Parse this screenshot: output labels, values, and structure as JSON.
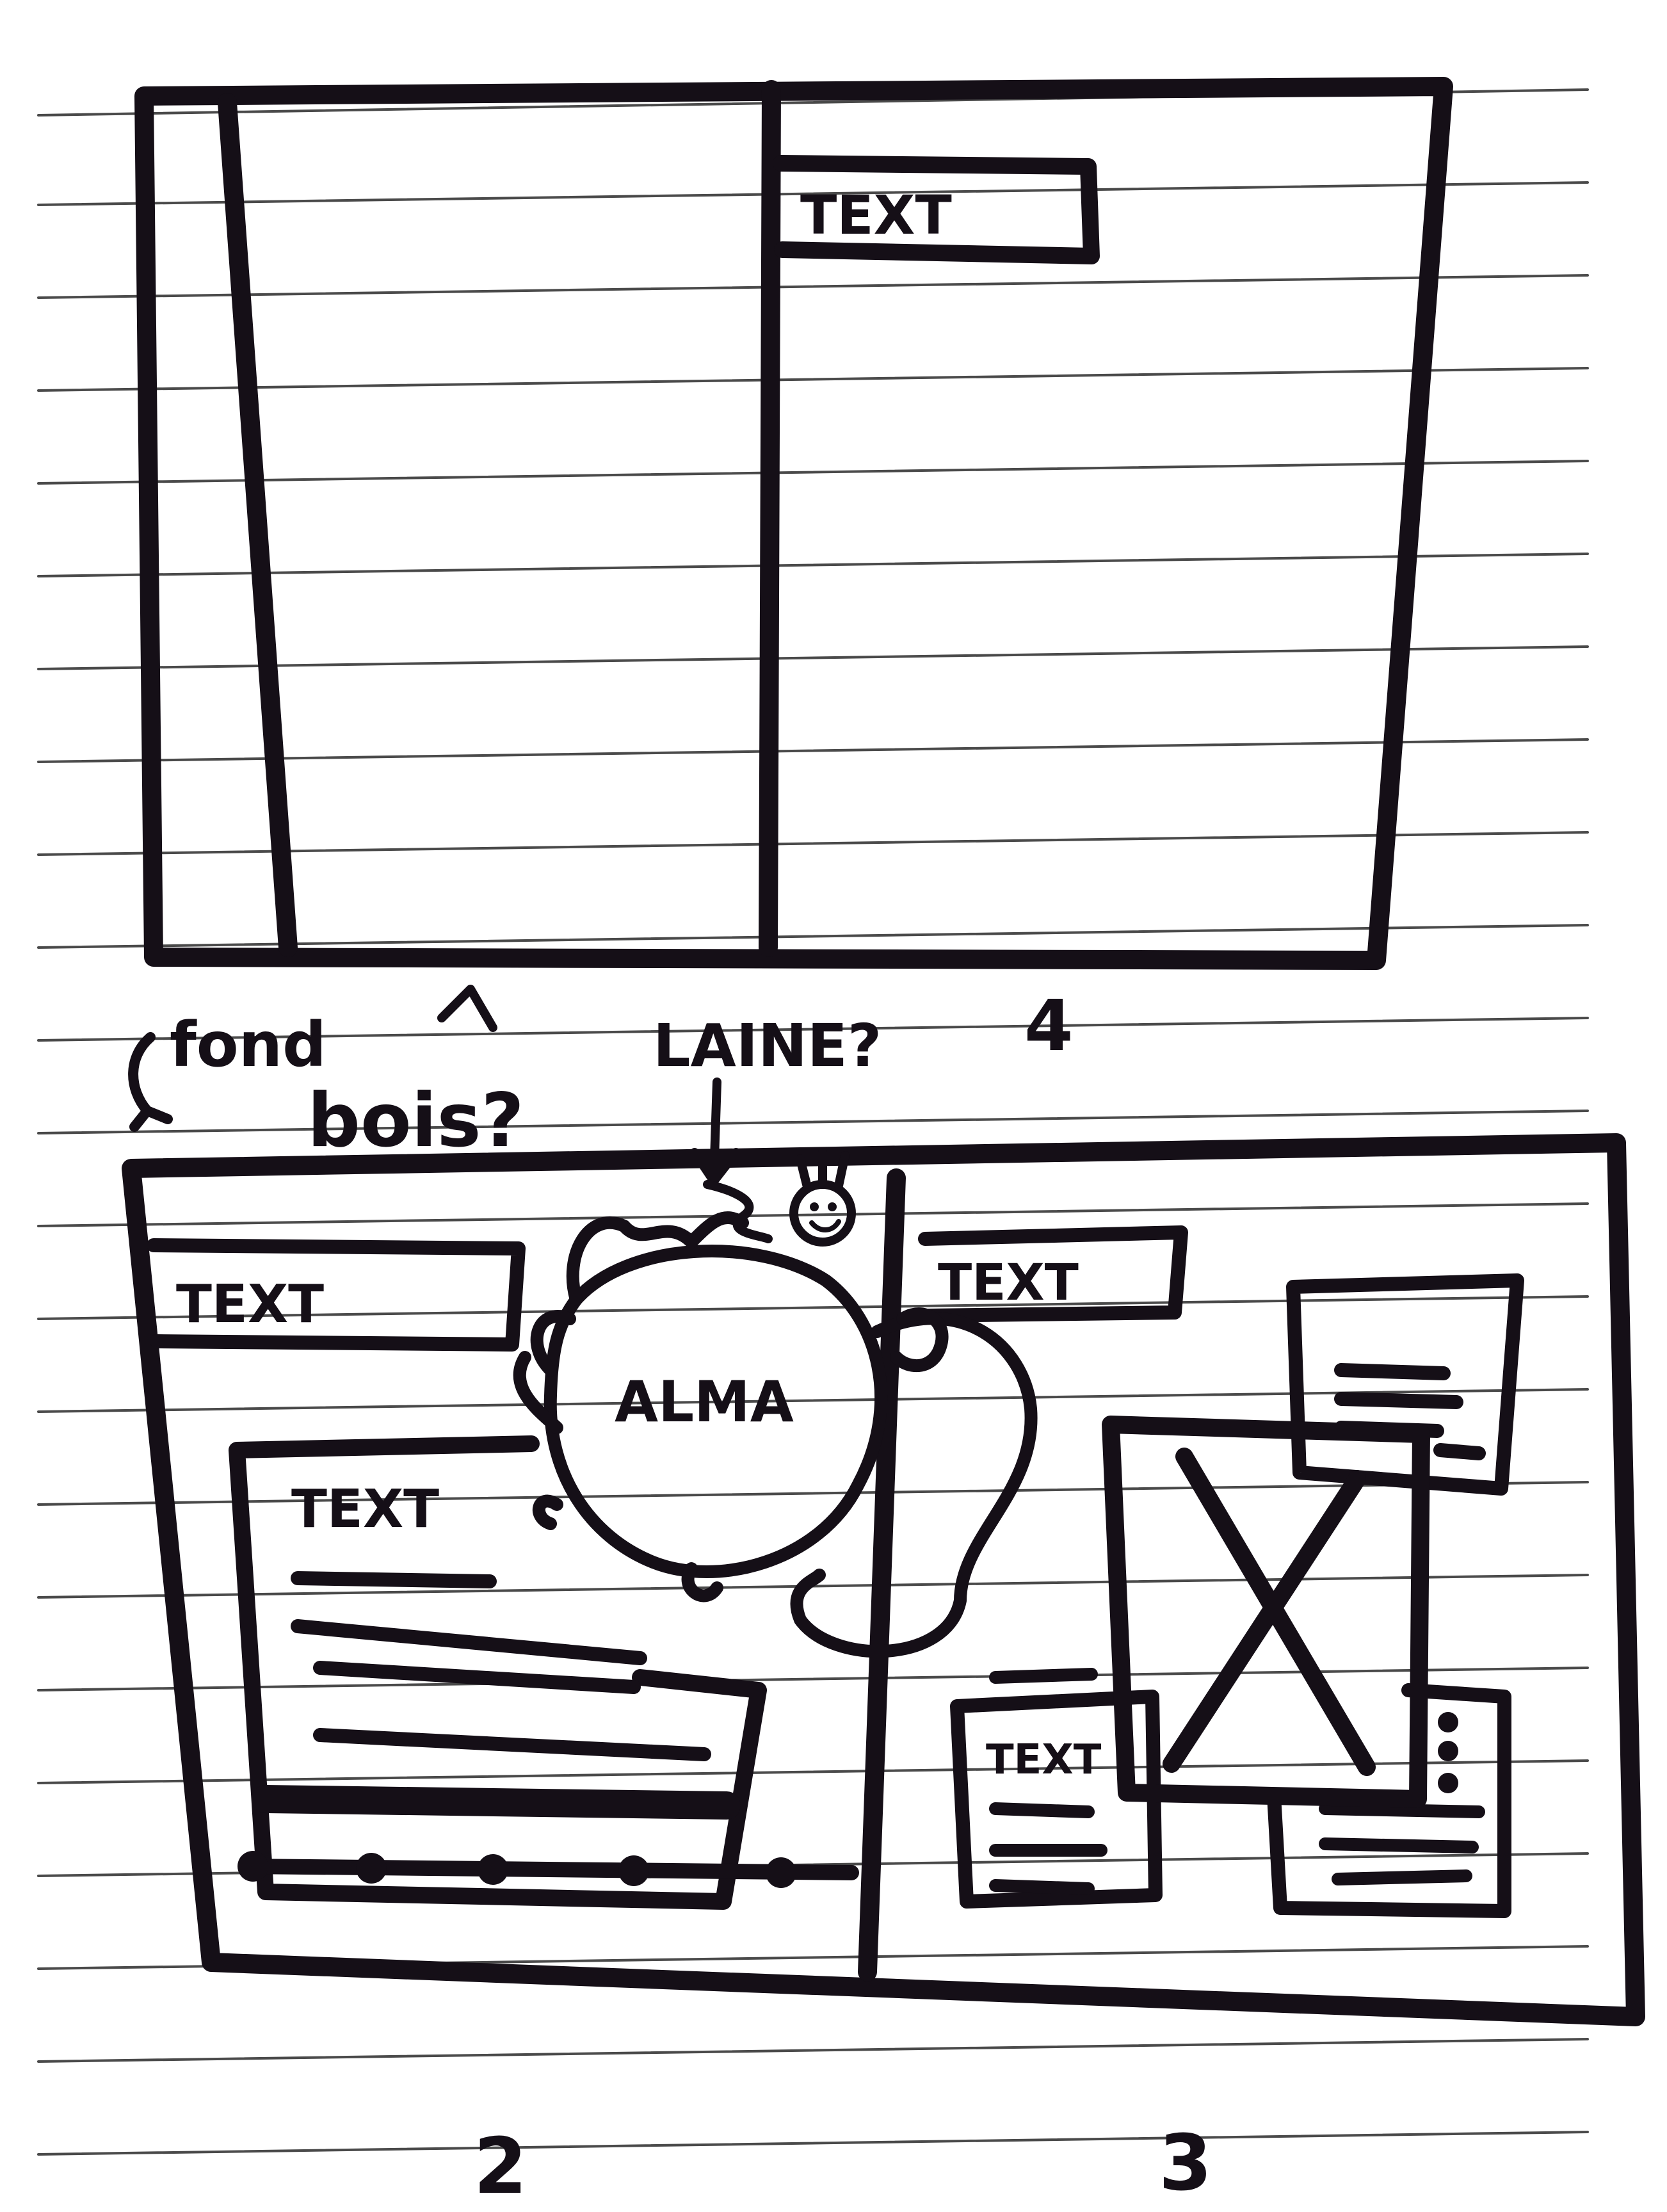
{
  "colors": {
    "ink": "#150f17",
    "paper": "#ffffff",
    "rule": "#4a4a4a"
  },
  "panel_top": {
    "text_box": "TEXT"
  },
  "annotations": {
    "fond": "fond",
    "bois": "bois?",
    "laine": "LAINE?",
    "page_number_top": "4"
  },
  "panel_bottom_left": {
    "header_text": "TEXT",
    "card_text": "TEXT",
    "character_name": "ALMA"
  },
  "panel_bottom_right": {
    "header_text": "TEXT",
    "small_card_text": "TEXT"
  },
  "page_numbers": {
    "left": "2",
    "right": "3"
  }
}
